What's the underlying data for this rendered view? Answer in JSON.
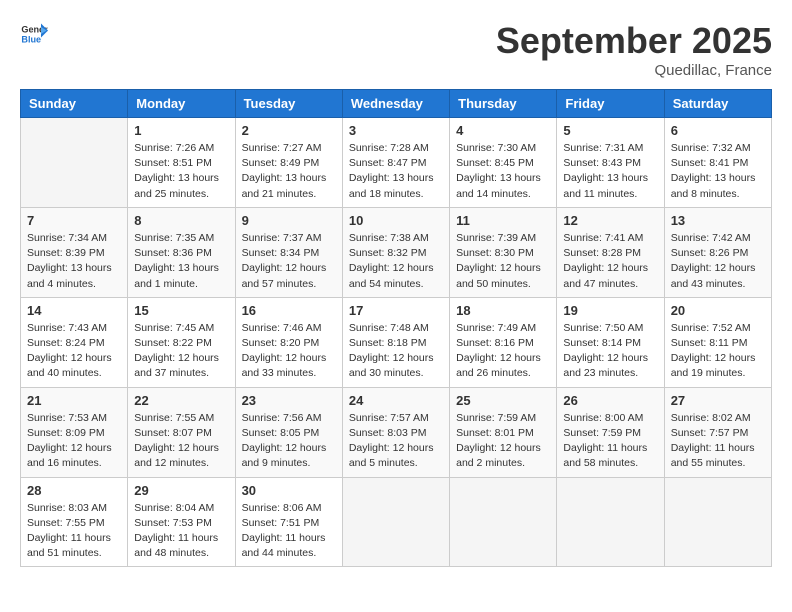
{
  "header": {
    "logo_general": "General",
    "logo_blue": "Blue",
    "month": "September 2025",
    "location": "Quedillac, France"
  },
  "weekdays": [
    "Sunday",
    "Monday",
    "Tuesday",
    "Wednesday",
    "Thursday",
    "Friday",
    "Saturday"
  ],
  "weeks": [
    [
      {
        "day": "",
        "empty": true
      },
      {
        "day": "1",
        "sunrise": "Sunrise: 7:26 AM",
        "sunset": "Sunset: 8:51 PM",
        "daylight": "Daylight: 13 hours and 25 minutes."
      },
      {
        "day": "2",
        "sunrise": "Sunrise: 7:27 AM",
        "sunset": "Sunset: 8:49 PM",
        "daylight": "Daylight: 13 hours and 21 minutes."
      },
      {
        "day": "3",
        "sunrise": "Sunrise: 7:28 AM",
        "sunset": "Sunset: 8:47 PM",
        "daylight": "Daylight: 13 hours and 18 minutes."
      },
      {
        "day": "4",
        "sunrise": "Sunrise: 7:30 AM",
        "sunset": "Sunset: 8:45 PM",
        "daylight": "Daylight: 13 hours and 14 minutes."
      },
      {
        "day": "5",
        "sunrise": "Sunrise: 7:31 AM",
        "sunset": "Sunset: 8:43 PM",
        "daylight": "Daylight: 13 hours and 11 minutes."
      },
      {
        "day": "6",
        "sunrise": "Sunrise: 7:32 AM",
        "sunset": "Sunset: 8:41 PM",
        "daylight": "Daylight: 13 hours and 8 minutes."
      }
    ],
    [
      {
        "day": "7",
        "sunrise": "Sunrise: 7:34 AM",
        "sunset": "Sunset: 8:39 PM",
        "daylight": "Daylight: 13 hours and 4 minutes."
      },
      {
        "day": "8",
        "sunrise": "Sunrise: 7:35 AM",
        "sunset": "Sunset: 8:36 PM",
        "daylight": "Daylight: 13 hours and 1 minute."
      },
      {
        "day": "9",
        "sunrise": "Sunrise: 7:37 AM",
        "sunset": "Sunset: 8:34 PM",
        "daylight": "Daylight: 12 hours and 57 minutes."
      },
      {
        "day": "10",
        "sunrise": "Sunrise: 7:38 AM",
        "sunset": "Sunset: 8:32 PM",
        "daylight": "Daylight: 12 hours and 54 minutes."
      },
      {
        "day": "11",
        "sunrise": "Sunrise: 7:39 AM",
        "sunset": "Sunset: 8:30 PM",
        "daylight": "Daylight: 12 hours and 50 minutes."
      },
      {
        "day": "12",
        "sunrise": "Sunrise: 7:41 AM",
        "sunset": "Sunset: 8:28 PM",
        "daylight": "Daylight: 12 hours and 47 minutes."
      },
      {
        "day": "13",
        "sunrise": "Sunrise: 7:42 AM",
        "sunset": "Sunset: 8:26 PM",
        "daylight": "Daylight: 12 hours and 43 minutes."
      }
    ],
    [
      {
        "day": "14",
        "sunrise": "Sunrise: 7:43 AM",
        "sunset": "Sunset: 8:24 PM",
        "daylight": "Daylight: 12 hours and 40 minutes."
      },
      {
        "day": "15",
        "sunrise": "Sunrise: 7:45 AM",
        "sunset": "Sunset: 8:22 PM",
        "daylight": "Daylight: 12 hours and 37 minutes."
      },
      {
        "day": "16",
        "sunrise": "Sunrise: 7:46 AM",
        "sunset": "Sunset: 8:20 PM",
        "daylight": "Daylight: 12 hours and 33 minutes."
      },
      {
        "day": "17",
        "sunrise": "Sunrise: 7:48 AM",
        "sunset": "Sunset: 8:18 PM",
        "daylight": "Daylight: 12 hours and 30 minutes."
      },
      {
        "day": "18",
        "sunrise": "Sunrise: 7:49 AM",
        "sunset": "Sunset: 8:16 PM",
        "daylight": "Daylight: 12 hours and 26 minutes."
      },
      {
        "day": "19",
        "sunrise": "Sunrise: 7:50 AM",
        "sunset": "Sunset: 8:14 PM",
        "daylight": "Daylight: 12 hours and 23 minutes."
      },
      {
        "day": "20",
        "sunrise": "Sunrise: 7:52 AM",
        "sunset": "Sunset: 8:11 PM",
        "daylight": "Daylight: 12 hours and 19 minutes."
      }
    ],
    [
      {
        "day": "21",
        "sunrise": "Sunrise: 7:53 AM",
        "sunset": "Sunset: 8:09 PM",
        "daylight": "Daylight: 12 hours and 16 minutes."
      },
      {
        "day": "22",
        "sunrise": "Sunrise: 7:55 AM",
        "sunset": "Sunset: 8:07 PM",
        "daylight": "Daylight: 12 hours and 12 minutes."
      },
      {
        "day": "23",
        "sunrise": "Sunrise: 7:56 AM",
        "sunset": "Sunset: 8:05 PM",
        "daylight": "Daylight: 12 hours and 9 minutes."
      },
      {
        "day": "24",
        "sunrise": "Sunrise: 7:57 AM",
        "sunset": "Sunset: 8:03 PM",
        "daylight": "Daylight: 12 hours and 5 minutes."
      },
      {
        "day": "25",
        "sunrise": "Sunrise: 7:59 AM",
        "sunset": "Sunset: 8:01 PM",
        "daylight": "Daylight: 12 hours and 2 minutes."
      },
      {
        "day": "26",
        "sunrise": "Sunrise: 8:00 AM",
        "sunset": "Sunset: 7:59 PM",
        "daylight": "Daylight: 11 hours and 58 minutes."
      },
      {
        "day": "27",
        "sunrise": "Sunrise: 8:02 AM",
        "sunset": "Sunset: 7:57 PM",
        "daylight": "Daylight: 11 hours and 55 minutes."
      }
    ],
    [
      {
        "day": "28",
        "sunrise": "Sunrise: 8:03 AM",
        "sunset": "Sunset: 7:55 PM",
        "daylight": "Daylight: 11 hours and 51 minutes."
      },
      {
        "day": "29",
        "sunrise": "Sunrise: 8:04 AM",
        "sunset": "Sunset: 7:53 PM",
        "daylight": "Daylight: 11 hours and 48 minutes."
      },
      {
        "day": "30",
        "sunrise": "Sunrise: 8:06 AM",
        "sunset": "Sunset: 7:51 PM",
        "daylight": "Daylight: 11 hours and 44 minutes."
      },
      {
        "day": "",
        "empty": true
      },
      {
        "day": "",
        "empty": true
      },
      {
        "day": "",
        "empty": true
      },
      {
        "day": "",
        "empty": true
      }
    ]
  ]
}
